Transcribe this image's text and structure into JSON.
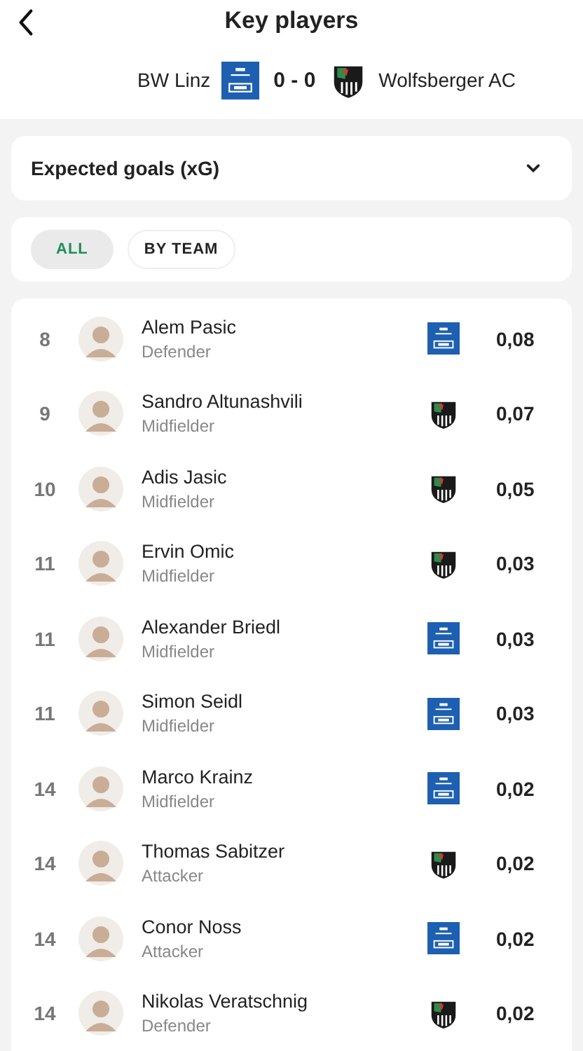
{
  "header": {
    "title": "Key players"
  },
  "match": {
    "home_team": "BW Linz",
    "score": "0 - 0",
    "away_team": "Wolfsberger AC"
  },
  "stat_dropdown": {
    "value": "Expected goals (xG)"
  },
  "filter_tabs": [
    {
      "label": "ALL",
      "selected": true
    },
    {
      "label": "BY TEAM",
      "selected": false
    }
  ],
  "players": [
    {
      "rank": "8",
      "name": "Alem Pasic",
      "position": "Defender",
      "kind": "home",
      "value": "0,08"
    },
    {
      "rank": "9",
      "name": "Sandro Altunashvili",
      "position": "Midfielder",
      "kind": "away",
      "value": "0,07"
    },
    {
      "rank": "10",
      "name": "Adis Jasic",
      "position": "Midfielder",
      "kind": "away",
      "value": "0,05"
    },
    {
      "rank": "11",
      "name": "Ervin Omic",
      "position": "Midfielder",
      "kind": "away",
      "value": "0,03"
    },
    {
      "rank": "11",
      "name": "Alexander Briedl",
      "position": "Midfielder",
      "kind": "home",
      "value": "0,03"
    },
    {
      "rank": "11",
      "name": "Simon Seidl",
      "position": "Midfielder",
      "kind": "home",
      "value": "0,03"
    },
    {
      "rank": "14",
      "name": "Marco Krainz",
      "position": "Midfielder",
      "kind": "home",
      "value": "0,02"
    },
    {
      "rank": "14",
      "name": "Thomas Sabitzer",
      "position": "Attacker",
      "kind": "away",
      "value": "0,02"
    },
    {
      "rank": "14",
      "name": "Conor Noss",
      "position": "Attacker",
      "kind": "home",
      "value": "0,02"
    },
    {
      "rank": "14",
      "name": "Nikolas Veratschnig",
      "position": "Defender",
      "kind": "away",
      "value": "0,02"
    }
  ]
}
